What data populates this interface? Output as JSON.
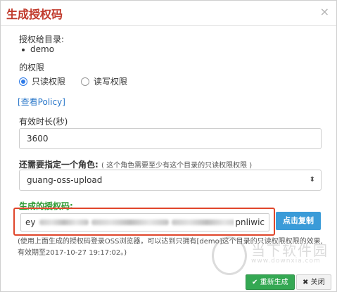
{
  "dialog": {
    "title": "生成授权码",
    "close_glyph": "×"
  },
  "dir_section": {
    "label": "授权给目录:",
    "items": [
      "demo"
    ]
  },
  "permission": {
    "label": "的权限",
    "options": [
      {
        "label": "只读权限",
        "checked": true
      },
      {
        "label": "读写权限",
        "checked": false
      }
    ],
    "policy_link": "[查看Policy]"
  },
  "validity": {
    "label": "有效时长(秒)",
    "value": "3600"
  },
  "role": {
    "label": "还需要指定一个角色:",
    "hint": "( 这个角色需要至少有这个目录的只读权限权限 )",
    "selected": "guang-oss-upload",
    "arrow": "⬍"
  },
  "auth_code": {
    "label": "生成的授权码:",
    "prefix": "ey",
    "suffix": "pnliwic",
    "copy_button": "点击复制"
  },
  "note": "(使用上面生成的授权码登录OSS浏览器，可以达到只拥有[demo]这个目录的只读权限权限的效果,有效期至2017-10-27 19:17:02。)",
  "footer": {
    "regenerate_icon": "✔",
    "regenerate": "重新生成",
    "close_icon": "✖",
    "close": "关闭"
  },
  "watermark": {
    "text": "当下软件园",
    "sub": "www.downxia.com"
  }
}
